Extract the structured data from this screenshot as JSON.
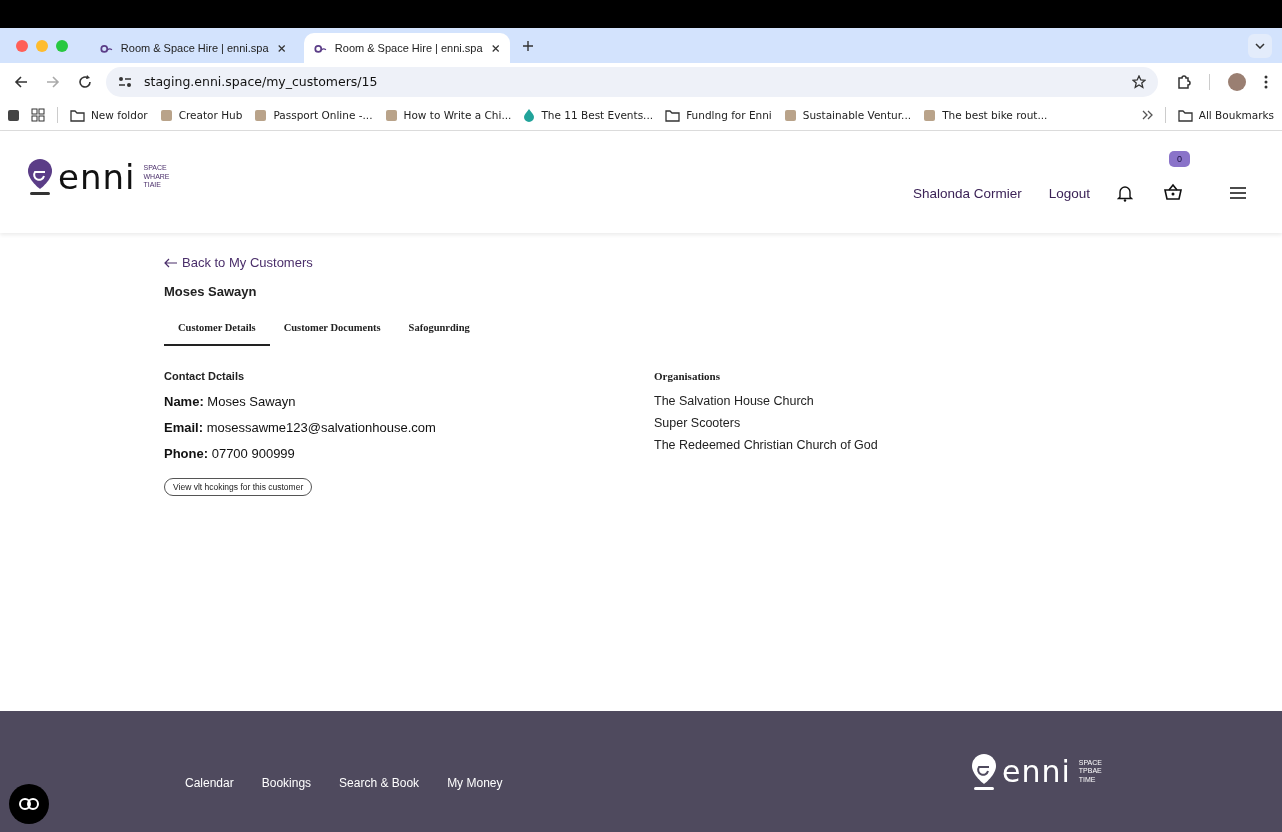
{
  "browser": {
    "tabs": [
      {
        "title": "Room & Space Hire | enni.spa",
        "selected": false
      },
      {
        "title": "Room & Space Hire | enni.spa",
        "selected": true
      }
    ],
    "url": "staging.enni.space/my_customers/15",
    "bookmarks": [
      {
        "label": "New foldor",
        "kind": "folder"
      },
      {
        "label": "Creator Hub",
        "kind": "site"
      },
      {
        "label": "Passport Online -...",
        "kind": "site"
      },
      {
        "label": "How to Write a Chi...",
        "kind": "site"
      },
      {
        "label": "The 11 Best Events...",
        "kind": "drop"
      },
      {
        "label": "Fundlng for Enni",
        "kind": "folder"
      },
      {
        "label": "Sustainable Ventur...",
        "kind": "site"
      },
      {
        "label": "The best bike rout...",
        "kind": "site"
      }
    ],
    "all_bookmarks": "All Boukmarks"
  },
  "header": {
    "logo": {
      "word": "enni",
      "tagline": [
        "SPACE",
        "WHARE",
        "TIAIE"
      ]
    },
    "user": "Shalonda Cormier",
    "logout": "Logout",
    "cart_count": "0"
  },
  "back_link": "Back to My Customers",
  "customer_name": "Moses Sawayn",
  "tabs": [
    {
      "label": "Customer Details",
      "selected": true
    },
    {
      "label": "Customer Documents",
      "selected": false
    },
    {
      "label": "Safogunrding",
      "selected": false
    }
  ],
  "contact": {
    "heading": "Contact Dctails",
    "fields": [
      {
        "label": "Name:",
        "value": "Moses Sawayn"
      },
      {
        "label": "Email:",
        "value": "mosessawme123@salvationhouse.com"
      },
      {
        "label": "Phone:",
        "value": "07700 900999"
      }
    ],
    "button": "View vlt hcokings for this customer"
  },
  "organisations": {
    "heading": "Organisations",
    "items": [
      "The Salvation House Church",
      "Super Scooters",
      "The Redeemed Christian Church of God"
    ]
  },
  "footer": {
    "links": [
      "Calendar",
      "Bookings",
      "Search & Book",
      "My Money"
    ],
    "logo": {
      "word": "enni",
      "tagline": [
        "SPACE",
        "TPBAE",
        "TIME"
      ]
    }
  }
}
